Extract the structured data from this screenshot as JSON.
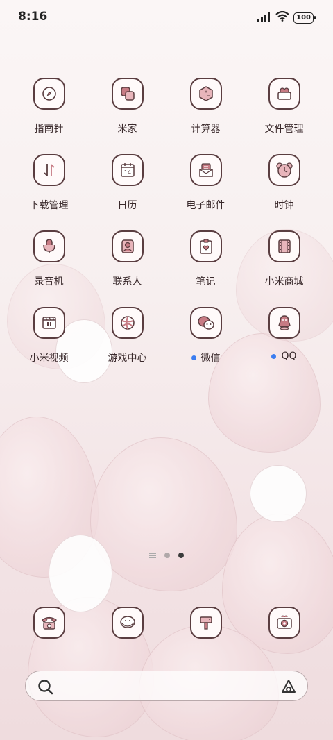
{
  "status": {
    "time": "8:16",
    "battery": "100"
  },
  "apps": [
    {
      "label": "指南针",
      "icon": "compass-icon"
    },
    {
      "label": "米家",
      "icon": "mijia-icon"
    },
    {
      "label": "计算器",
      "icon": "calculator-icon"
    },
    {
      "label": "文件管理",
      "icon": "folder-icon"
    },
    {
      "label": "下载管理",
      "icon": "download-icon"
    },
    {
      "label": "日历",
      "icon": "calendar-icon",
      "date": "14"
    },
    {
      "label": "电子邮件",
      "icon": "mail-icon"
    },
    {
      "label": "时钟",
      "icon": "clock-icon"
    },
    {
      "label": "录音机",
      "icon": "recorder-icon"
    },
    {
      "label": "联系人",
      "icon": "contacts-icon"
    },
    {
      "label": "笔记",
      "icon": "notes-icon"
    },
    {
      "label": "小米商城",
      "icon": "store-icon"
    },
    {
      "label": "小米视频",
      "icon": "video-icon"
    },
    {
      "label": "游戏中心",
      "icon": "game-center-icon"
    },
    {
      "label": "微信",
      "icon": "wechat-icon",
      "notification": true
    },
    {
      "label": "QQ",
      "icon": "qq-icon",
      "notification": true
    }
  ],
  "pager": {
    "pages": 3,
    "current": 3
  },
  "dock": [
    {
      "icon": "phone-icon"
    },
    {
      "icon": "messages-icon"
    },
    {
      "icon": "browser-icon"
    },
    {
      "icon": "camera-icon"
    }
  ],
  "colors": {
    "icon_stroke": "#5a3d40",
    "icon_fill": "#c77b84",
    "notification_dot": "#3b7df0"
  }
}
